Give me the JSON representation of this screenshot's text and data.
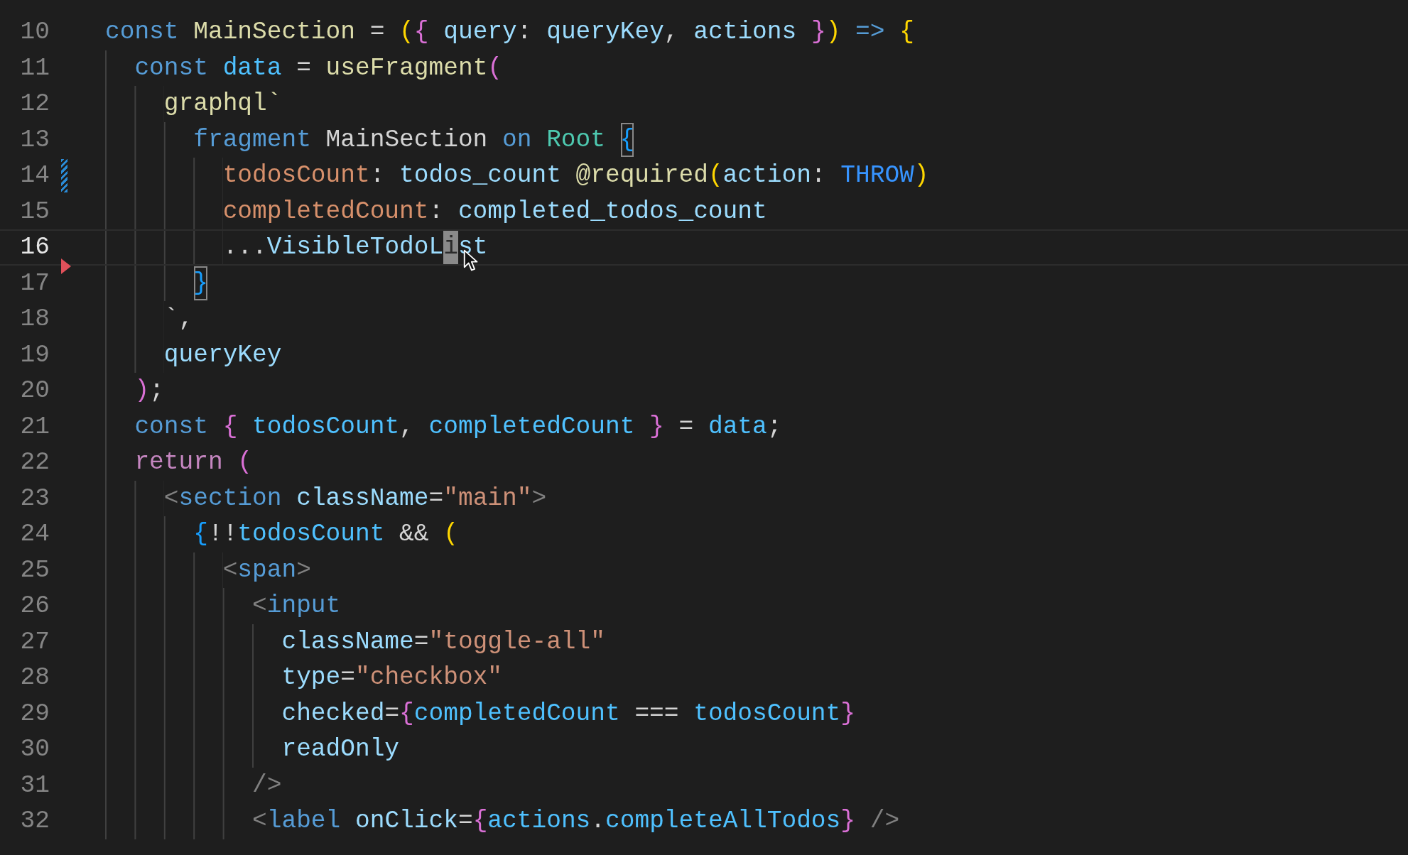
{
  "editor": {
    "lines": [
      {
        "number": "10",
        "current": false,
        "modified": false,
        "deleted": false,
        "tokens": [
          {
            "text": "const",
            "kind": "kw"
          },
          {
            "text": " MainSection",
            "kind": "fn"
          },
          {
            "text": " = ",
            "kind": "plain"
          },
          {
            "text": "(",
            "kind": "b1"
          },
          {
            "text": "{",
            "kind": "b2"
          },
          {
            "text": " query",
            "kind": "var"
          },
          {
            "text": ": ",
            "kind": "plain"
          },
          {
            "text": "queryKey",
            "kind": "var"
          },
          {
            "text": ", ",
            "kind": "plain"
          },
          {
            "text": "actions",
            "kind": "var"
          },
          {
            "text": " }",
            "kind": "b2"
          },
          {
            "text": ")",
            "kind": "b1"
          },
          {
            "text": " =>",
            "kind": "kw"
          },
          {
            "text": " {",
            "kind": "b1"
          }
        ]
      },
      {
        "number": "11",
        "current": false,
        "modified": false,
        "deleted": false,
        "tokens": [
          {
            "text": "  const",
            "kind": "kw"
          },
          {
            "text": " data",
            "kind": "const"
          },
          {
            "text": " = ",
            "kind": "plain"
          },
          {
            "text": "useFragment",
            "kind": "fn"
          },
          {
            "text": "(",
            "kind": "b2"
          }
        ]
      },
      {
        "number": "12",
        "current": false,
        "modified": false,
        "deleted": false,
        "tokens": [
          {
            "text": "    graphql`",
            "kind": "fn"
          }
        ]
      },
      {
        "number": "13",
        "current": false,
        "modified": false,
        "deleted": false,
        "tokens": [
          {
            "text": "      fragment",
            "kind": "kw"
          },
          {
            "text": " MainSection ",
            "kind": "plain"
          },
          {
            "text": "on",
            "kind": "kw"
          },
          {
            "text": " Root ",
            "kind": "type"
          },
          {
            "text": "{",
            "kind": "b3-match"
          }
        ]
      },
      {
        "number": "14",
        "current": false,
        "modified": true,
        "deleted": false,
        "tokens": [
          {
            "text": "        todosCount",
            "kind": "field"
          },
          {
            "text": ": ",
            "kind": "plain"
          },
          {
            "text": "todos_count",
            "kind": "var"
          },
          {
            "text": " @required",
            "kind": "fn"
          },
          {
            "text": "(",
            "kind": "b1"
          },
          {
            "text": "action",
            "kind": "var"
          },
          {
            "text": ": ",
            "kind": "plain"
          },
          {
            "text": "THROW",
            "kind": "enum"
          },
          {
            "text": ")",
            "kind": "b1"
          }
        ]
      },
      {
        "number": "15",
        "current": false,
        "modified": false,
        "deleted": false,
        "tokens": [
          {
            "text": "        completedCount",
            "kind": "field"
          },
          {
            "text": ": ",
            "kind": "plain"
          },
          {
            "text": "completed_todos_count",
            "kind": "var"
          }
        ]
      },
      {
        "number": "16",
        "current": true,
        "modified": false,
        "deleted": true,
        "tokens": [
          {
            "text": "        ...",
            "kind": "plain"
          },
          {
            "text": "VisibleTodoL",
            "kind": "var"
          },
          {
            "text": "i",
            "kind": "selection"
          },
          {
            "text": "st",
            "kind": "var"
          }
        ]
      },
      {
        "number": "17",
        "current": false,
        "modified": false,
        "deleted": false,
        "tokens": [
          {
            "text": "      }",
            "kind": "b3-match"
          }
        ]
      },
      {
        "number": "18",
        "current": false,
        "modified": false,
        "deleted": false,
        "tokens": [
          {
            "text": "    `,",
            "kind": "plain"
          }
        ]
      },
      {
        "number": "19",
        "current": false,
        "modified": false,
        "deleted": false,
        "tokens": [
          {
            "text": "    queryKey",
            "kind": "var"
          }
        ]
      },
      {
        "number": "20",
        "current": false,
        "modified": false,
        "deleted": false,
        "tokens": [
          {
            "text": "  )",
            "kind": "b2"
          },
          {
            "text": ";",
            "kind": "plain"
          }
        ]
      },
      {
        "number": "21",
        "current": false,
        "modified": false,
        "deleted": false,
        "tokens": [
          {
            "text": "  const",
            "kind": "kw"
          },
          {
            "text": " {",
            "kind": "b2"
          },
          {
            "text": " todosCount",
            "kind": "const"
          },
          {
            "text": ", ",
            "kind": "plain"
          },
          {
            "text": "completedCount",
            "kind": "const"
          },
          {
            "text": " }",
            "kind": "b2"
          },
          {
            "text": " = ",
            "kind": "plain"
          },
          {
            "text": "data",
            "kind": "const"
          },
          {
            "text": ";",
            "kind": "plain"
          }
        ]
      },
      {
        "number": "22",
        "current": false,
        "modified": false,
        "deleted": false,
        "tokens": [
          {
            "text": "  return",
            "kind": "ctl"
          },
          {
            "text": " (",
            "kind": "b2"
          }
        ]
      },
      {
        "number": "23",
        "current": false,
        "modified": false,
        "deleted": false,
        "tokens": [
          {
            "text": "    <",
            "kind": "punct"
          },
          {
            "text": "section",
            "kind": "kw"
          },
          {
            "text": " className",
            "kind": "var"
          },
          {
            "text": "=",
            "kind": "plain"
          },
          {
            "text": "\"main\"",
            "kind": "str"
          },
          {
            "text": ">",
            "kind": "punct"
          }
        ]
      },
      {
        "number": "24",
        "current": false,
        "modified": false,
        "deleted": false,
        "tokens": [
          {
            "text": "      {",
            "kind": "b3"
          },
          {
            "text": "!!",
            "kind": "plain"
          },
          {
            "text": "todosCount",
            "kind": "const"
          },
          {
            "text": " && ",
            "kind": "plain"
          },
          {
            "text": "(",
            "kind": "b1"
          }
        ]
      },
      {
        "number": "25",
        "current": false,
        "modified": false,
        "deleted": false,
        "tokens": [
          {
            "text": "        <",
            "kind": "punct"
          },
          {
            "text": "span",
            "kind": "kw"
          },
          {
            "text": ">",
            "kind": "punct"
          }
        ]
      },
      {
        "number": "26",
        "current": false,
        "modified": false,
        "deleted": false,
        "tokens": [
          {
            "text": "          <",
            "kind": "punct"
          },
          {
            "text": "input",
            "kind": "kw"
          }
        ]
      },
      {
        "number": "27",
        "current": false,
        "modified": false,
        "deleted": false,
        "tokens": [
          {
            "text": "            className",
            "kind": "var"
          },
          {
            "text": "=",
            "kind": "plain"
          },
          {
            "text": "\"toggle-all\"",
            "kind": "str"
          }
        ]
      },
      {
        "number": "28",
        "current": false,
        "modified": false,
        "deleted": false,
        "tokens": [
          {
            "text": "            type",
            "kind": "var"
          },
          {
            "text": "=",
            "kind": "plain"
          },
          {
            "text": "\"checkbox\"",
            "kind": "str"
          }
        ]
      },
      {
        "number": "29",
        "current": false,
        "modified": false,
        "deleted": false,
        "tokens": [
          {
            "text": "            checked",
            "kind": "var"
          },
          {
            "text": "=",
            "kind": "plain"
          },
          {
            "text": "{",
            "kind": "b2"
          },
          {
            "text": "completedCount",
            "kind": "const"
          },
          {
            "text": " === ",
            "kind": "plain"
          },
          {
            "text": "todosCount",
            "kind": "const"
          },
          {
            "text": "}",
            "kind": "b2"
          }
        ]
      },
      {
        "number": "30",
        "current": false,
        "modified": false,
        "deleted": false,
        "tokens": [
          {
            "text": "            readOnly",
            "kind": "var"
          }
        ]
      },
      {
        "number": "31",
        "current": false,
        "modified": false,
        "deleted": false,
        "tokens": [
          {
            "text": "          />",
            "kind": "punct"
          }
        ]
      },
      {
        "number": "32",
        "current": false,
        "modified": false,
        "deleted": false,
        "tokens": [
          {
            "text": "          <",
            "kind": "punct"
          },
          {
            "text": "label",
            "kind": "kw"
          },
          {
            "text": " onClick",
            "kind": "var"
          },
          {
            "text": "=",
            "kind": "plain"
          },
          {
            "text": "{",
            "kind": "b2"
          },
          {
            "text": "actions",
            "kind": "const"
          },
          {
            "text": ".",
            "kind": "plain"
          },
          {
            "text": "completeAllTodos",
            "kind": "const"
          },
          {
            "text": "}",
            "kind": "b2"
          },
          {
            "text": " />",
            "kind": "punct"
          }
        ]
      }
    ]
  }
}
